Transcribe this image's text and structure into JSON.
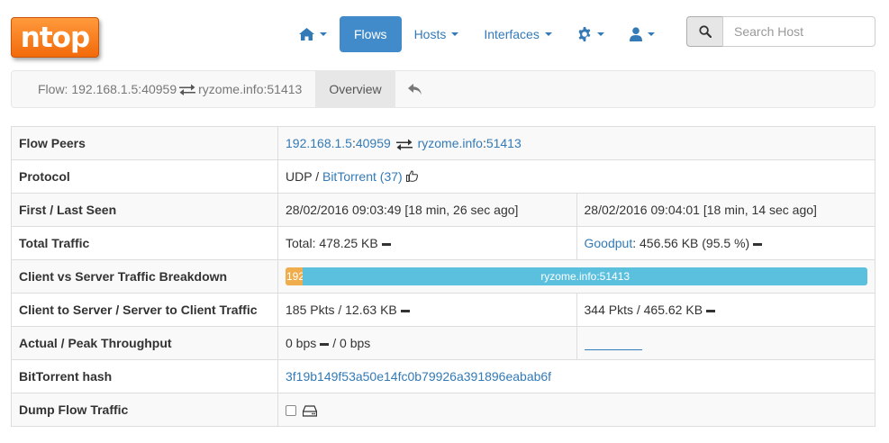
{
  "logo": {
    "text": "ntop"
  },
  "nav": {
    "home_icon": "home-icon",
    "flows_label": "Flows",
    "hosts_label": "Hosts",
    "interfaces_label": "Interfaces",
    "settings_icon": "gear-icon",
    "user_icon": "user-icon"
  },
  "search": {
    "icon": "search-icon",
    "placeholder": "Search Host"
  },
  "breadcrumb": {
    "prefix": "Flow:",
    "client": "192.168.1.5:40959",
    "server": "ryzome.info:51413",
    "tab_overview": "Overview",
    "back_icon": "reply-icon"
  },
  "colors": {
    "active_nav": "#428bca",
    "link": "#337ab7",
    "client_bar": "#f0ad4e",
    "server_bar": "#5bc0de",
    "logo": "#f26a0a"
  },
  "table": {
    "flow_peers": {
      "label": "Flow Peers",
      "client_host": "192.168.1.5",
      "client_port": "40959",
      "server_host": "ryzome.info",
      "server_port": "51413"
    },
    "protocol": {
      "label": "Protocol",
      "l4": "UDP",
      "sep": "/",
      "app": "BitTorrent (37)",
      "icon": "thumbs-up-icon"
    },
    "first_last_seen": {
      "label": "First / Last Seen",
      "first": "28/02/2016 09:03:49 [18 min, 26 sec ago]",
      "last": "28/02/2016 09:04:01 [18 min, 14 sec ago]"
    },
    "total_traffic": {
      "label": "Total Traffic",
      "total": "Total: 478.25 KB",
      "goodput_link": "Goodput",
      "goodput_value": ": 456.56 KB (95.5 %)"
    },
    "breakdown": {
      "label": "Client vs Server Traffic Breakdown",
      "client_label": "192",
      "server_label": "ryzome.info:51413",
      "client_fraction": 0.03
    },
    "c2s_s2c": {
      "label": "Client to Server / Server to Client Traffic",
      "c2s": "185 Pkts / 12.63 KB",
      "s2c": "344 Pkts / 465.62 KB"
    },
    "throughput": {
      "label": "Actual / Peak Throughput",
      "actual": "0 bps",
      "peak": "/ 0 bps"
    },
    "bittorrent_hash": {
      "label": "BitTorrent hash",
      "value": "3f19b149f53a50e14fc0b79926a391896eabab6f"
    },
    "dump": {
      "label": "Dump Flow Traffic",
      "icon": "hdd-icon"
    }
  }
}
